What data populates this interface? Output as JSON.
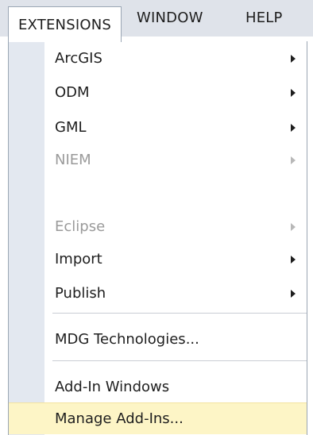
{
  "menubar": {
    "items": [
      "EXTENSIONS",
      "WINDOW",
      "HELP"
    ]
  },
  "menu": {
    "items": [
      {
        "label": "ArcGIS",
        "submenu": true,
        "enabled": true
      },
      {
        "label": "ODM",
        "submenu": true,
        "enabled": true
      },
      {
        "label": "GML",
        "submenu": true,
        "enabled": true
      },
      {
        "label": "NIEM",
        "submenu": true,
        "enabled": false
      },
      {
        "label": "Eclipse",
        "submenu": true,
        "enabled": false
      },
      {
        "label": "Import",
        "submenu": true,
        "enabled": true
      },
      {
        "label": "Publish",
        "submenu": true,
        "enabled": true
      },
      {
        "label": "MDG Technologies...",
        "submenu": false,
        "enabled": true
      },
      {
        "label": "Add-In Windows",
        "submenu": false,
        "enabled": true
      },
      {
        "label": "Manage Add-Ins...",
        "submenu": false,
        "enabled": true,
        "highlighted": true
      }
    ]
  },
  "colors": {
    "menubar_bg": "#dfe3ea",
    "gutter_bg": "#e3e8f0",
    "highlight_bg": "#fdf5c6",
    "disabled_text": "#9a9a9a"
  }
}
